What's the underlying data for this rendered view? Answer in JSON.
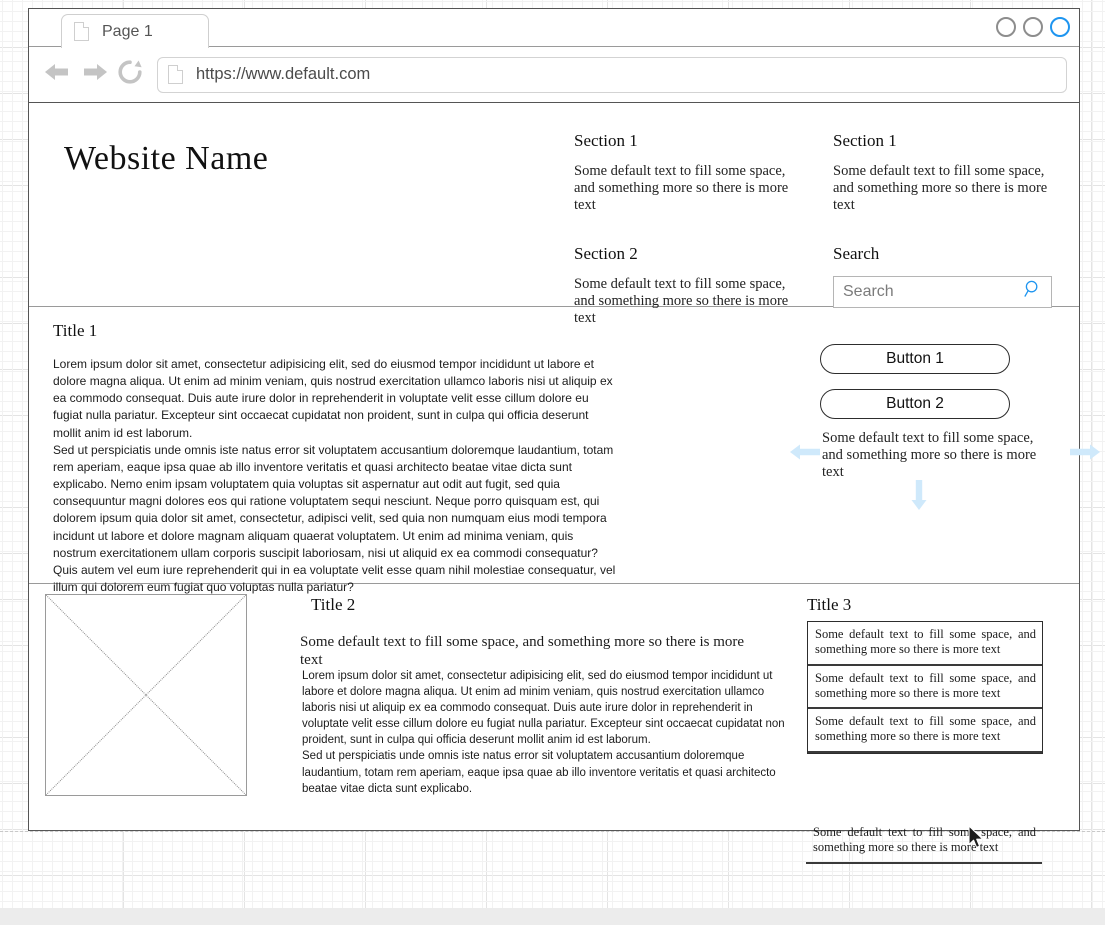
{
  "browser": {
    "tab": {
      "label": "Page 1",
      "icon": "document-icon"
    },
    "window_controls": [
      {
        "name": "minimize",
        "color": "#8d8d8d",
        "active": false
      },
      {
        "name": "maximize",
        "color": "#8d8d8d",
        "active": false
      },
      {
        "name": "close",
        "color": "#1e95f0",
        "active": true
      }
    ],
    "nav": {
      "back_icon": "arrow-left-icon",
      "forward_icon": "arrow-right-icon",
      "reload_icon": "reload-icon"
    },
    "address": {
      "favicon": "page-icon",
      "url": "https://www.default.com"
    }
  },
  "site": {
    "title": "Website Name",
    "header_columns": [
      {
        "blocks": [
          {
            "heading": "Section 1",
            "body": "Some default text to fill some space, and  something more so there is more text"
          },
          {
            "heading": "Section 2",
            "body": "Some default text to fill some space, and  something more so there is more text"
          }
        ]
      },
      {
        "blocks": [
          {
            "heading": "Section 1",
            "body": "Some default text to fill some space, and  something more so there is more text"
          }
        ],
        "search": {
          "heading": "Search",
          "placeholder": "Search",
          "value": "",
          "icon": "search-icon",
          "icon_color": "#1e95f0"
        }
      }
    ],
    "main": {
      "title": "Title 1",
      "paragraph_1": "Lorem ipsum dolor sit amet, consectetur adipisicing elit, sed do eiusmod tempor incididunt ut labore et dolore magna aliqua. Ut enim ad minim veniam, quis nostrud exercitation ullamco laboris nisi ut aliquip ex ea commodo consequat. Duis aute irure dolor in reprehenderit in voluptate velit esse cillum dolore eu fugiat nulla pariatur. Excepteur sint occaecat cupidatat non proident, sunt in culpa qui officia deserunt mollit anim id est laborum.",
      "paragraph_2": "Sed ut perspiciatis unde omnis iste natus error sit voluptatem accusantium doloremque laudantium, totam rem aperiam, eaque ipsa quae ab illo inventore veritatis et quasi architecto beatae vitae dicta sunt explicabo. Nemo enim ipsam voluptatem quia voluptas sit aspernatur aut odit aut fugit, sed quia consequuntur magni dolores eos qui ratione voluptatem sequi nesciunt. Neque porro quisquam est, qui dolorem ipsum quia dolor sit amet, consectetur, adipisci velit, sed quia non numquam eius modi tempora incidunt ut labore et dolore magnam aliquam quaerat voluptatem. Ut enim ad minima veniam, quis nostrum exercitationem ullam corporis suscipit laboriosam, nisi ut aliquid ex ea commodi consequatur? Quis autem vel eum iure reprehenderit qui in ea voluptate velit esse quam nihil molestiae consequatur, vel illum qui dolorem eum fugiat quo voluptas nulla pariatur?",
      "buttons": [
        {
          "label": "Button 1"
        },
        {
          "label": "Button 2"
        }
      ],
      "carousel": {
        "text": "Some default text to fill some space, and  something more so there is more text",
        "arrow_color": "#cfe9fb",
        "arrows": [
          "arrow-left-icon",
          "arrow-right-icon",
          "arrow-down-icon"
        ]
      }
    },
    "bottom": {
      "image_placeholder": {
        "name": "image-placeholder"
      },
      "title2": "Title 2",
      "title2_lead": "Some default text to fill some space, and  something more so there is more text",
      "title2_body_1": "Lorem ipsum dolor sit amet, consectetur adipisicing elit, sed do eiusmod tempor incididunt ut labore et dolore magna aliqua. Ut enim ad minim veniam, quis nostrud exercitation ullamco laboris nisi ut aliquip ex ea commodo consequat. Duis aute irure dolor in reprehenderit in voluptate velit esse cillum dolore eu fugiat nulla pariatur. Excepteur sint occaecat cupidatat non proident, sunt in culpa qui officia deserunt mollit anim id est laborum.",
      "title2_body_2": "Sed ut perspiciatis unde omnis iste natus error sit voluptatem accusantium doloremque laudantium, totam rem aperiam, eaque ipsa quae ab illo inventore veritatis et quasi architecto beatae vitae dicta sunt explicabo.",
      "title3": "Title 3",
      "list_items": [
        "Some default text to fill some space, and  something more so there is more text",
        "Some default text to fill some space, and  something more so there is more text",
        "Some default text to fill some space, and  something more so there is more text",
        "Some default text to fill some space, and  something more so there is more text"
      ]
    }
  }
}
